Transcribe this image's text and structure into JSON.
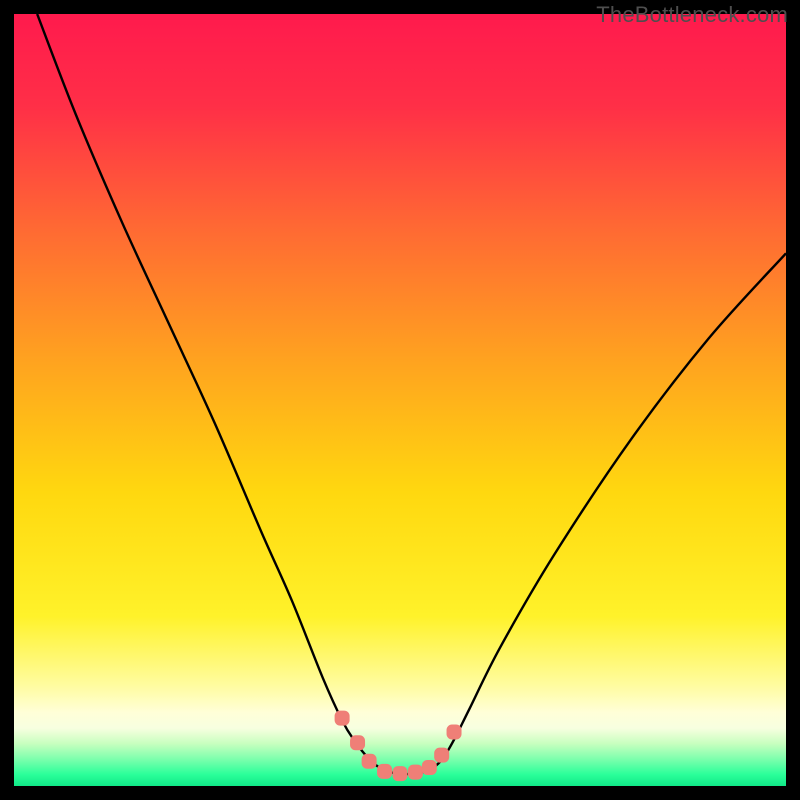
{
  "watermark": "TheBottleneck.com",
  "colors": {
    "gradient_stops": [
      {
        "offset": 0.0,
        "color": "#ff1a4d"
      },
      {
        "offset": 0.12,
        "color": "#ff2f47"
      },
      {
        "offset": 0.28,
        "color": "#ff6a33"
      },
      {
        "offset": 0.45,
        "color": "#ffa31f"
      },
      {
        "offset": 0.62,
        "color": "#ffd80f"
      },
      {
        "offset": 0.78,
        "color": "#fff22a"
      },
      {
        "offset": 0.87,
        "color": "#fffca0"
      },
      {
        "offset": 0.905,
        "color": "#ffffd8"
      },
      {
        "offset": 0.925,
        "color": "#f7ffe0"
      },
      {
        "offset": 0.945,
        "color": "#c8ffbf"
      },
      {
        "offset": 0.965,
        "color": "#7dffad"
      },
      {
        "offset": 0.985,
        "color": "#2bff9a"
      },
      {
        "offset": 1.0,
        "color": "#10e887"
      }
    ],
    "curve": "#000000",
    "marker_fill": "#ef7f77",
    "marker_stroke": "#ef7f77"
  },
  "chart_data": {
    "type": "line",
    "title": "",
    "xlabel": "",
    "ylabel": "",
    "xlim": [
      0,
      100
    ],
    "ylim": [
      0,
      100
    ],
    "grid": false,
    "series": [
      {
        "name": "bottleneck-curve",
        "x": [
          3,
          8,
          14,
          20,
          26,
          32,
          36,
          40,
          42.5,
          44,
          46,
          48,
          50,
          52,
          54,
          55.5,
          57,
          59,
          63,
          70,
          80,
          90,
          100
        ],
        "y": [
          100,
          87,
          73,
          60,
          47,
          33,
          24,
          14,
          8.5,
          6,
          3.5,
          2,
          1.6,
          1.6,
          2.2,
          3.5,
          6,
          10,
          18,
          30,
          45,
          58,
          69
        ]
      }
    ],
    "markers": {
      "name": "highlight-points",
      "x": [
        42.5,
        44.5,
        46,
        48,
        50,
        52,
        53.8,
        55.4,
        57
      ],
      "y": [
        8.8,
        5.6,
        3.2,
        1.9,
        1.6,
        1.8,
        2.4,
        4.0,
        7.0
      ]
    }
  }
}
